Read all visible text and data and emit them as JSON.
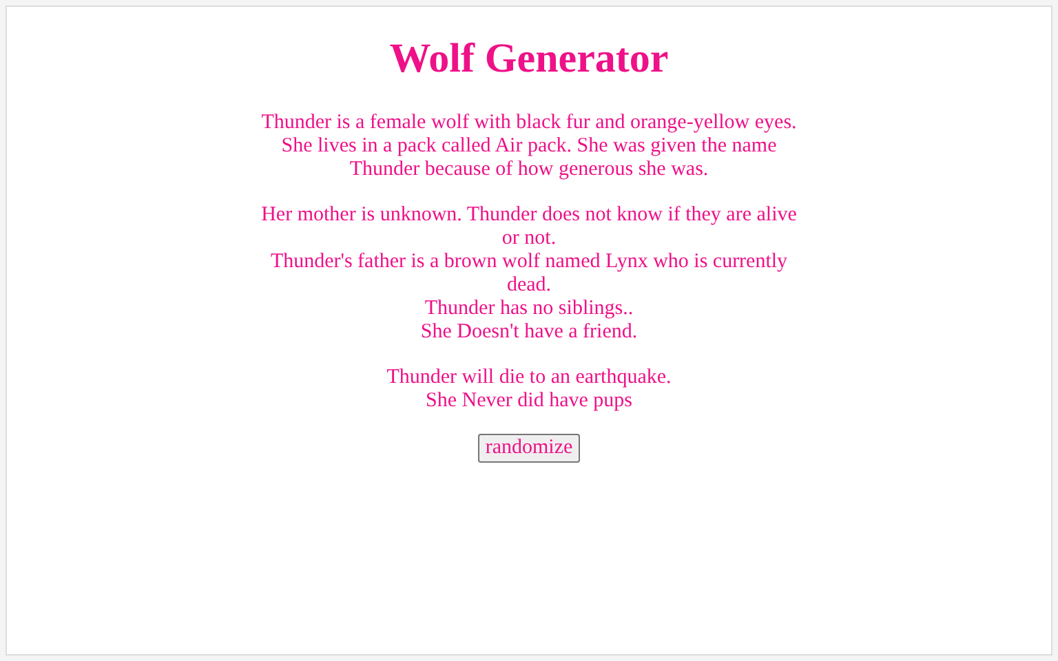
{
  "title": "Wolf Generator",
  "paragraphs": [
    [
      "Thunder is a female wolf with black fur and orange-yellow eyes. She lives in a pack called Air pack. She was given the name Thunder because of how generous she was."
    ],
    [
      "Her mother is unknown. Thunder does not know if they are alive or not.",
      "Thunder's father is a brown wolf named Lynx who is currently dead.",
      "Thunder has no siblings..",
      "She Doesn't have a friend."
    ],
    [
      "Thunder will die to an earthquake.",
      "She Never did have pups"
    ]
  ],
  "button": "randomize"
}
